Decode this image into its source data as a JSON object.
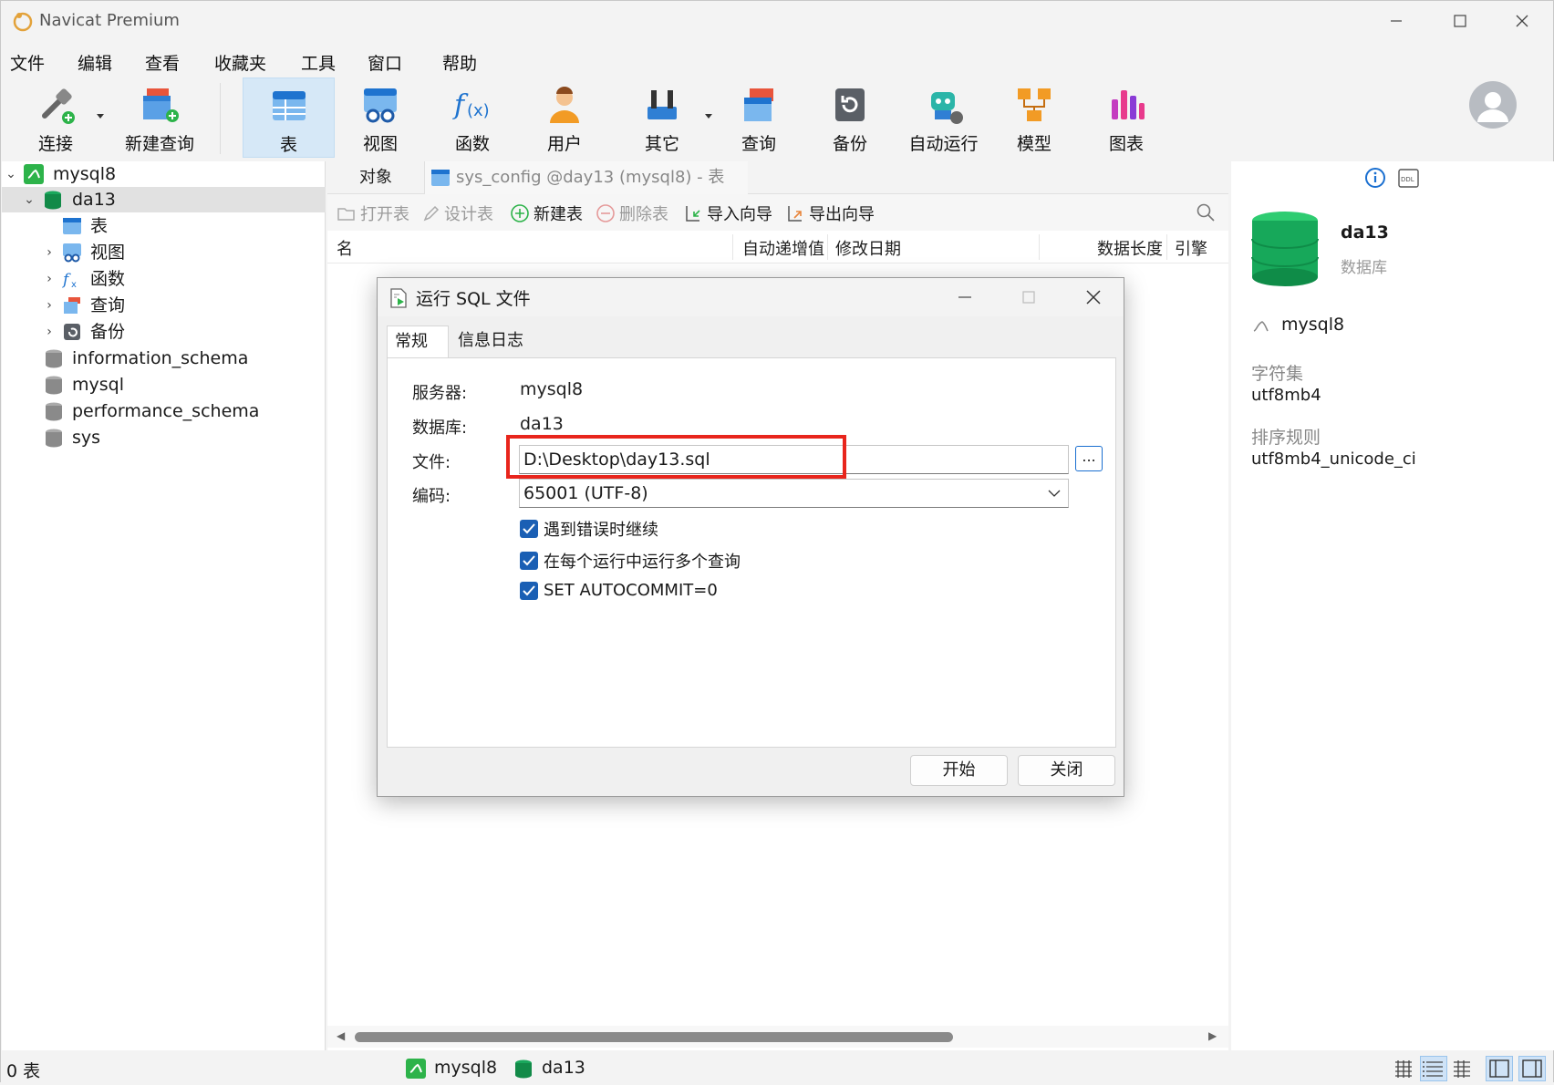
{
  "window": {
    "title": "Navicat Premium"
  },
  "menu": [
    "文件",
    "编辑",
    "查看",
    "收藏夹",
    "工具",
    "窗口",
    "帮助"
  ],
  "toolbar": {
    "connect": "连接",
    "new_query": "新建查询",
    "table": "表",
    "view": "视图",
    "function": "函数",
    "user": "用户",
    "other": "其它",
    "query": "查询",
    "backup": "备份",
    "automation": "自动运行",
    "model": "模型",
    "chart": "图表"
  },
  "tree": {
    "connection": "mysql8",
    "db_selected": "da13",
    "children": [
      "表",
      "视图",
      "函数",
      "查询",
      "备份"
    ],
    "databases": [
      "information_schema",
      "mysql",
      "performance_schema",
      "sys"
    ]
  },
  "center": {
    "tab_objects": "对象",
    "tab_doc": "sys_config @day13 (mysql8) - 表",
    "actions": {
      "open_table": "打开表",
      "design_table": "设计表",
      "new_table": "新建表",
      "delete_table": "删除表",
      "import_wizard": "导入向导",
      "export_wizard": "导出向导"
    },
    "columns": {
      "name": "名",
      "auto_inc": "自动递增值",
      "modified": "修改日期",
      "data_length": "数据长度",
      "engine": "引擎"
    }
  },
  "right": {
    "db_name": "da13",
    "db_type": "数据库",
    "connection": "mysql8",
    "charset_label": "字符集",
    "charset_value": "utf8mb4",
    "collation_label": "排序规则",
    "collation_value": "utf8mb4_unicode_ci"
  },
  "status": {
    "count": "0 表",
    "connection": "mysql8",
    "database": "da13"
  },
  "dialog": {
    "title": "运行 SQL 文件",
    "tabs": [
      "常规",
      "信息日志"
    ],
    "server_label": "服务器:",
    "server_value": "mysql8",
    "database_label": "数据库:",
    "database_value": "da13",
    "file_label": "文件:",
    "file_value": "D:\\Desktop\\day13.sql",
    "browse": "...",
    "encoding_label": "编码:",
    "encoding_value": "65001 (UTF-8)",
    "checks": [
      "遇到错误时继续",
      "在每个运行中运行多个查询",
      "SET AUTOCOMMIT=0"
    ],
    "start": "开始",
    "close": "关闭"
  },
  "colors": {
    "accent": "#1a5fb4",
    "highlight": "#e8251c",
    "active_tab": "#d6e8f7"
  }
}
